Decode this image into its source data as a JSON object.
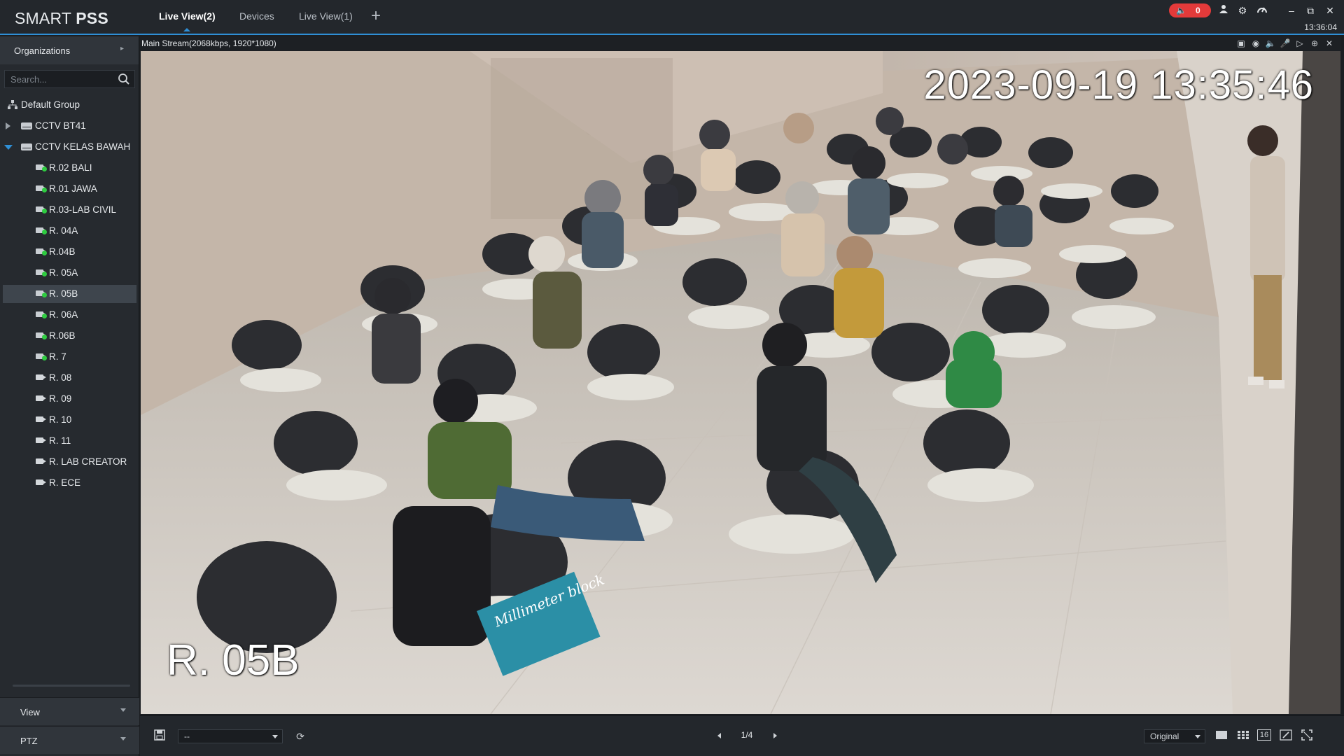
{
  "app": {
    "logo_light": "SMART ",
    "logo_bold": "PSS",
    "clock": "13:36:04"
  },
  "tabs": [
    {
      "label": "Live View(2)",
      "active": true
    },
    {
      "label": "Devices",
      "active": false
    },
    {
      "label": "Live View(1)",
      "active": false
    }
  ],
  "alarm": {
    "count": "0",
    "color": "#e33a3a"
  },
  "sidebar": {
    "header": "Organizations",
    "search_placeholder": "Search...",
    "root": "Default Group",
    "devices": [
      {
        "label": "CCTV BT41",
        "expanded": false
      },
      {
        "label": "CCTV KELAS BAWAH",
        "expanded": true
      }
    ],
    "channels": [
      {
        "label": "R.02 BALI",
        "online": true
      },
      {
        "label": "R.01 JAWA",
        "online": true
      },
      {
        "label": "R.03-LAB CIVIL",
        "online": true
      },
      {
        "label": "R. 04A",
        "online": true
      },
      {
        "label": "R.04B",
        "online": true
      },
      {
        "label": "R. 05A",
        "online": true
      },
      {
        "label": "R. 05B",
        "online": true,
        "selected": true
      },
      {
        "label": "R. 06A",
        "online": true
      },
      {
        "label": "R.06B",
        "online": true
      },
      {
        "label": "R. 7",
        "online": true
      },
      {
        "label": "R. 08",
        "online": false
      },
      {
        "label": "R. 09",
        "online": false
      },
      {
        "label": "R. 10",
        "online": false
      },
      {
        "label": "R. 11",
        "online": false
      },
      {
        "label": "R. LAB CREATOR",
        "online": false
      },
      {
        "label": "R. ECE",
        "online": false
      }
    ],
    "panels": [
      "View",
      "PTZ"
    ]
  },
  "video": {
    "stream_info": "Main Stream(2068kbps, 1920*1080)",
    "osd_timestamp": "2023-09-19 13:35:46",
    "osd_channel": "R. 05B",
    "notebook_text": "Millimeter block"
  },
  "bottom": {
    "view_select": "--",
    "page": "1/4",
    "ratio": "Original",
    "layout_16_label": "16"
  },
  "colors": {
    "accent": "#2f8fd6",
    "online": "#2ecc40"
  }
}
